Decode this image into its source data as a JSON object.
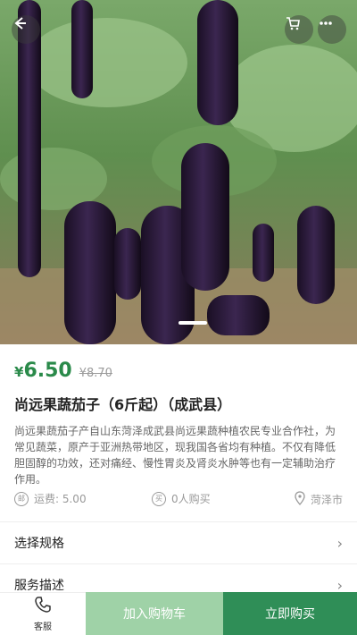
{
  "price": {
    "currency": "¥",
    "current": "6.50",
    "original": "¥8.70",
    "accent_color": "#2a8a4a"
  },
  "product": {
    "title": "尚远果蔬茄子（6斤起）（成武县）",
    "description": "尚远果蔬茄子产自山东菏泽成武县尚远果蔬种植农民专业合作社，为常见蔬菜，原产于亚洲热带地区，现我国各省均有种植。不仅有降低胆固醇的功效，还对痛经、慢性胃炎及肾炎水肿等也有一定辅助治疗作用。"
  },
  "meta": {
    "shipping": "运费: 5.00",
    "buyers": "0人购买",
    "location": "菏泽市"
  },
  "rows": {
    "spec": "选择规格",
    "service": "服务描述"
  },
  "bottom_bar": {
    "service_label": "客服",
    "add_cart": "加入购物车",
    "buy_now": "立即购买"
  },
  "icons": {
    "back": "back-arrow-icon",
    "cart": "cart-icon",
    "more": "more-icon",
    "shipping": "shipping-icon",
    "buyers": "buyers-icon",
    "location": "location-pin-icon",
    "phone": "phone-icon"
  }
}
